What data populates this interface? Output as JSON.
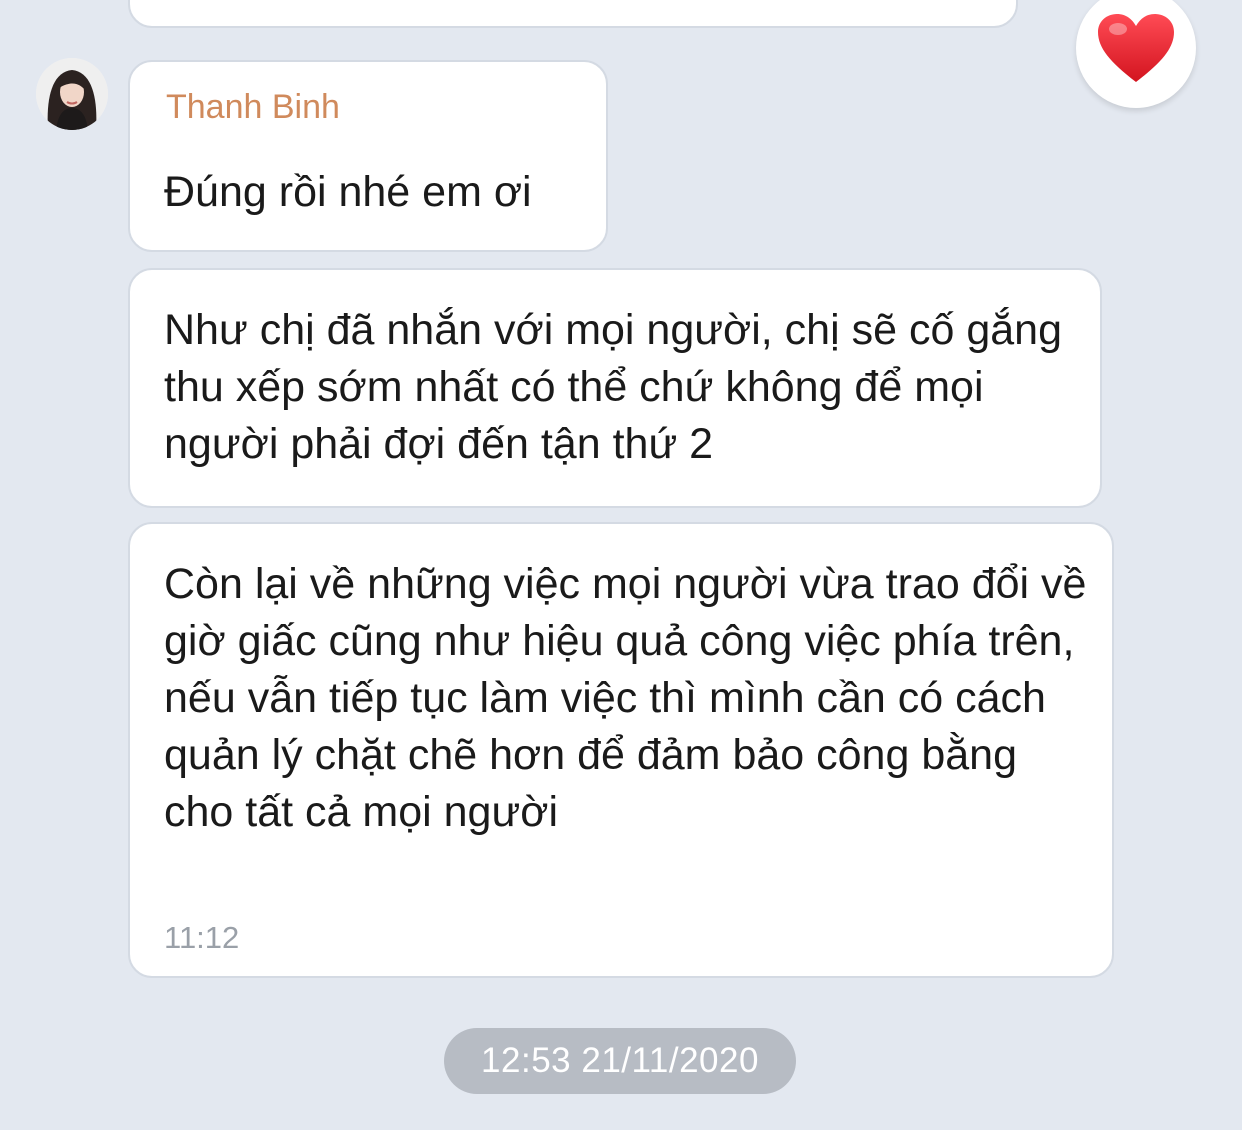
{
  "chat": {
    "messages": [
      {
        "sender": "Thanh Binh",
        "text": "Đúng rồi nhé em ơi"
      },
      {
        "text": "Như chị đã nhắn với mọi người, chị sẽ cố gắng thu xếp sớm nhất có thể chứ không để mọi người phải đợi đến tận thứ 2"
      },
      {
        "text": "Còn lại về những việc mọi người vừa trao đổi về giờ giấc cũng như hiệu quả công việc phía trên, nếu vẫn tiếp tục làm việc thì mình cần có cách quản lý chặt chẽ hơn để đảm bảo công bằng cho tất cả mọi người",
        "time": "11:12"
      }
    ],
    "reaction": {
      "icon": "heart-icon",
      "color": "#e2262f"
    },
    "date_separator": "12:53 21/11/2020"
  },
  "theme": {
    "background": "#e3e8f0",
    "sender_color": "#d08a5c",
    "bubble_background": "#ffffff"
  }
}
